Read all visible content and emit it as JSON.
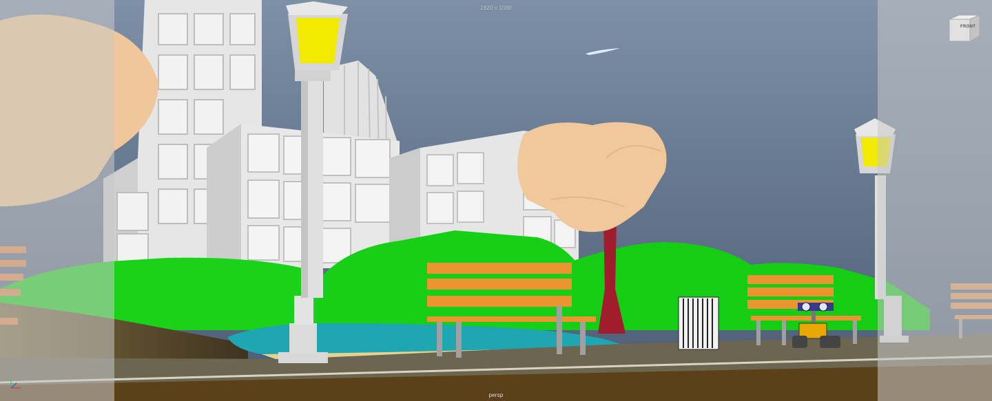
{
  "viewport": {
    "resolution_gate_label": "1920 x 1080",
    "camera_name": "persp",
    "view_cube_face": "FRONT",
    "axis_gizmo_icon": "axis-gizmo-icon",
    "view_cube_icon": "view-cube-icon"
  },
  "colors": {
    "sky_top": "#6f839a",
    "sky_bottom": "#4e5f77",
    "grass": "#18d018",
    "grass_dark": "#0fb80f",
    "building": "#e4e4e4",
    "tree_canopy": "#f0c79a",
    "tree_trunk": "#a01e2e",
    "bench_wood": "#ec9430",
    "bench_leg": "#9a9a9a",
    "lamp_glass": "#f2ea00",
    "pond": "#1fa7b3",
    "path_dirt": "#4a3a22",
    "road": "#6b6450"
  }
}
